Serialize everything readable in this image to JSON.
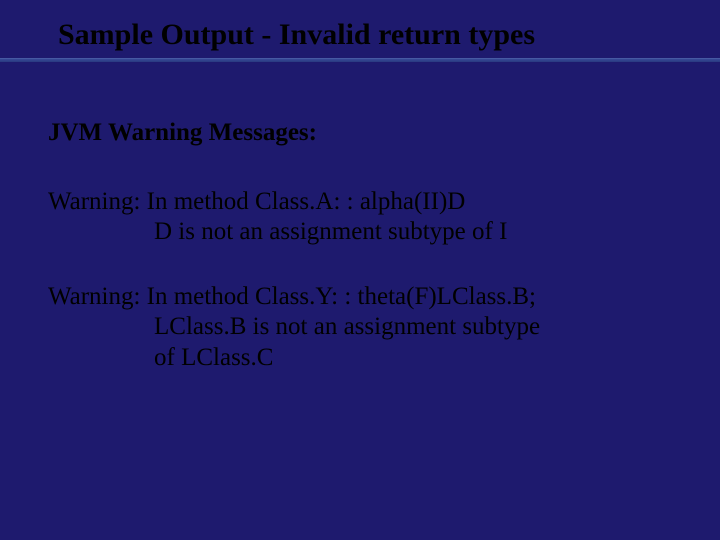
{
  "title": "Sample Output - Invalid return types",
  "heading": "JVM Warning Messages:",
  "warnings": [
    {
      "line1": "Warning: In method Class.A: : alpha(II)D",
      "cont": [
        "D is not an assignment subtype of I"
      ]
    },
    {
      "line1": "Warning: In method Class.Y: : theta(F)LClass.B;",
      "cont": [
        "LClass.B is not an assignment subtype",
        "of LClass.C"
      ]
    }
  ]
}
